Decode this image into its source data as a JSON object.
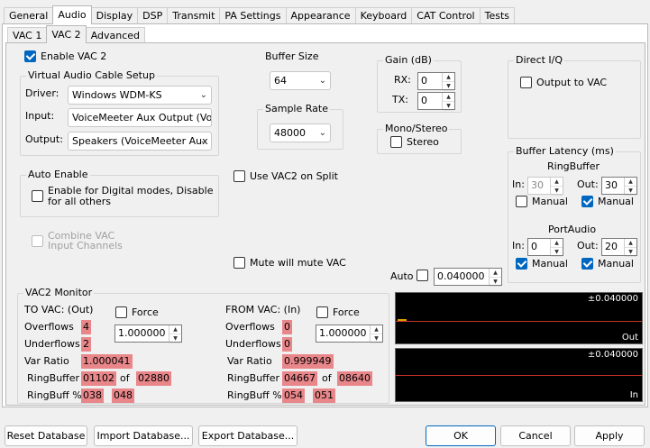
{
  "main_tabs": [
    "General",
    "Audio",
    "Display",
    "DSP",
    "Transmit",
    "PA Settings",
    "Appearance",
    "Keyboard",
    "CAT Control",
    "Tests"
  ],
  "main_tab_active": 1,
  "sub_tabs": [
    "VAC 1",
    "VAC 2",
    "Advanced"
  ],
  "sub_tab_active": 1,
  "enable_vac2": {
    "label": "Enable VAC 2",
    "checked": true
  },
  "vac_setup": {
    "legend": "Virtual Audio Cable Setup",
    "driver_label": "Driver:",
    "driver_value": "Windows WDM-KS",
    "input_label": "Input:",
    "input_value": "VoiceMeeter Aux Output (Voi",
    "output_label": "Output:",
    "output_value": "Speakers (VoiceMeeter Aux ·"
  },
  "buffer_size": {
    "legend": "Buffer Size",
    "value": "64"
  },
  "sample_rate": {
    "legend": "Sample Rate",
    "value": "48000"
  },
  "gain": {
    "legend": "Gain (dB)",
    "rx_label": "RX:",
    "rx_value": "0",
    "tx_label": "TX:",
    "tx_value": "0"
  },
  "mono_stereo": {
    "legend": "Mono/Stereo",
    "stereo_label": "Stereo"
  },
  "direct_iq": {
    "legend": "Direct I/Q",
    "output_label": "Output to VAC"
  },
  "auto_enable": {
    "legend": "Auto Enable",
    "label_line1": "Enable for Digital modes, Disable",
    "label_line2": "for all others"
  },
  "use_vac2_split": "Use VAC2 on Split",
  "combine_vac": {
    "line1": "Combine VAC",
    "line2": "Input Channels"
  },
  "mute_will_mute": "Mute will mute VAC",
  "auto": {
    "label": "Auto",
    "value": "0.040000"
  },
  "buffer_latency": {
    "legend": "Buffer Latency (ms)",
    "ringbuffer_title": "RingBuffer",
    "rb_in_label": "In:",
    "rb_in_value": "30",
    "rb_out_label": "Out:",
    "rb_out_value": "30",
    "rb_manual_in": "Manual",
    "rb_manual_out": "Manual",
    "portaudio_title": "PortAudio",
    "pa_in_label": "In:",
    "pa_in_value": "0",
    "pa_out_label": "Out:",
    "pa_out_value": "20",
    "pa_manual_in": "Manual",
    "pa_manual_out": "Manual"
  },
  "monitor": {
    "legend": "VAC2 Monitor",
    "to_title": "TO VAC: (Out)",
    "from_title": "FROM VAC: (In)",
    "force_label": "Force",
    "to_force_value": "1.000000",
    "from_force_value": "1.000000",
    "overflows_label": "Overflows",
    "underflows_label": "Underflows",
    "var_ratio_label": "Var Ratio",
    "ringbuffer_label": "RingBuffer",
    "ringbuff_pct_label": "RingBuff %",
    "of_label": "of",
    "to": {
      "overflows": "4",
      "underflows": "2",
      "var_ratio": "1.000041",
      "rb_a": "01102",
      "rb_b": "02880",
      "pct_a": "038",
      "pct_b": "048"
    },
    "from": {
      "overflows": "0",
      "underflows": "0",
      "var_ratio": "0.999949",
      "rb_a": "04667",
      "rb_b": "08640",
      "pct_a": "054",
      "pct_b": "051"
    }
  },
  "scope_out": {
    "top": "±0.040000",
    "bottom": "Out"
  },
  "scope_in": {
    "top": "±0.040000",
    "bottom": "In"
  },
  "buttons": {
    "reset": "Reset Database",
    "import": "Import Database...",
    "export": "Export Database...",
    "ok": "OK",
    "cancel": "Cancel",
    "apply": "Apply"
  }
}
